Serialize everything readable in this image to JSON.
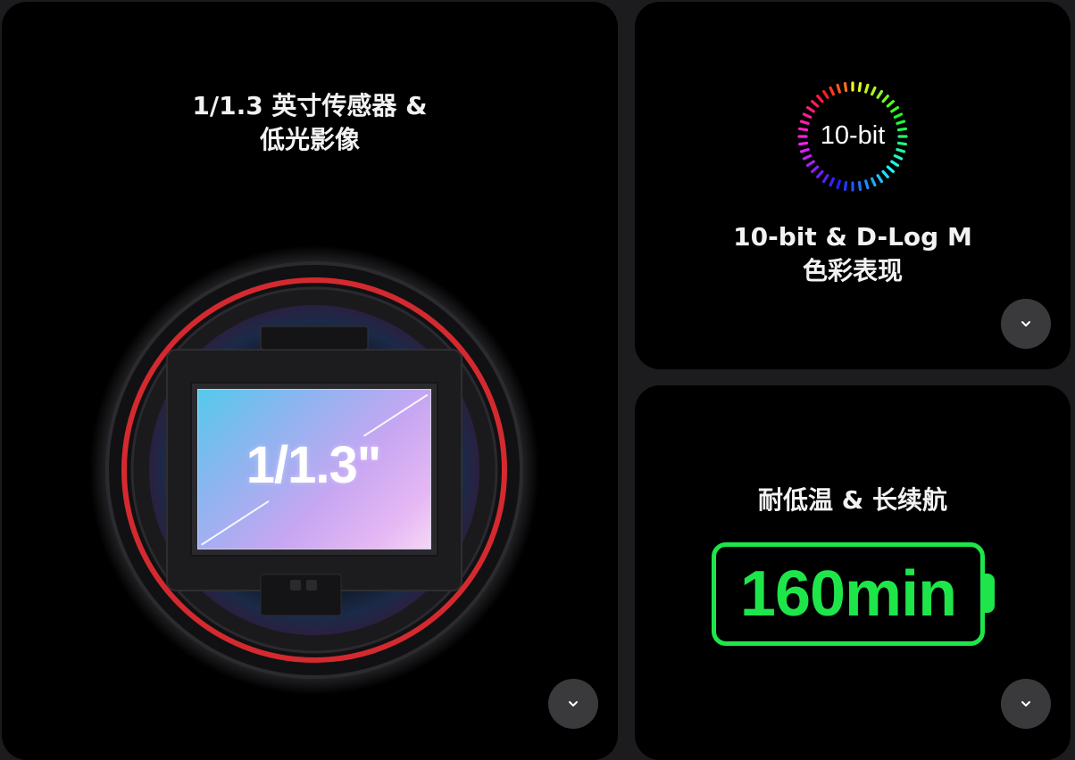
{
  "sensor_card": {
    "title_line1": "1/1.3 英寸传感器 &",
    "title_line2": "低光影像",
    "sensor_label": "1/1.3\"",
    "expand_icon": "chevron-down-icon"
  },
  "color_card": {
    "badge_text": "10-bit",
    "title_line1": "10-bit & D-Log M",
    "title_line2": "色彩表现",
    "expand_icon": "chevron-down-icon"
  },
  "battery_card": {
    "title": "耐低温 & 长续航",
    "battery_text": "160min",
    "expand_icon": "chevron-down-icon"
  },
  "colors": {
    "background": "#1c1c1e",
    "card": "#000000",
    "button": "#3a3a3c",
    "battery_green": "#1ee64a",
    "lens_ring_red": "#d42a2f"
  }
}
